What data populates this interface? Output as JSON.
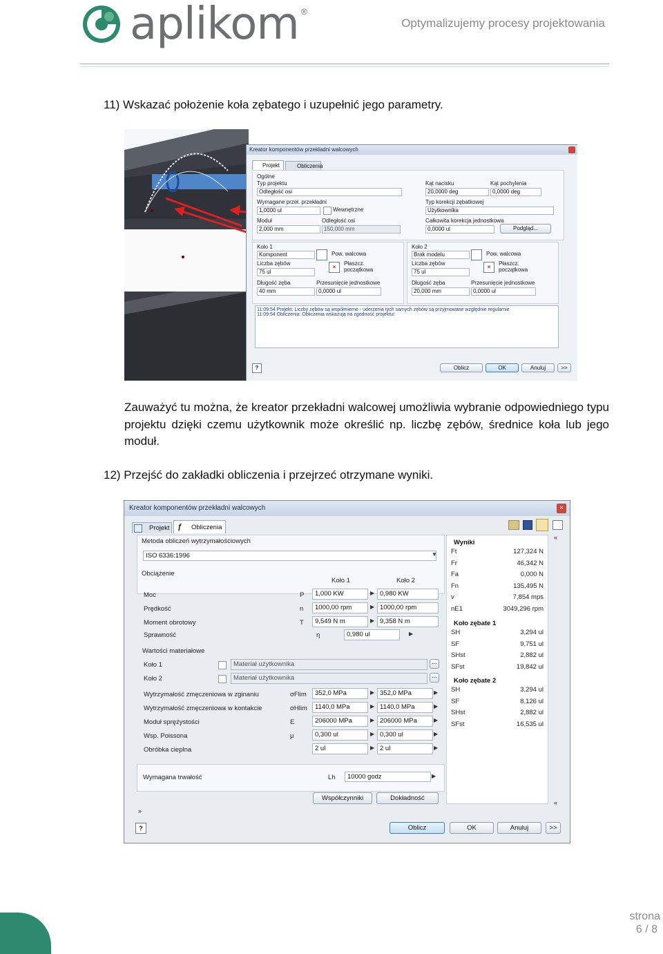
{
  "header": {
    "logo_text": "aplikom",
    "logo_reg": "®",
    "tagline": "Optymalizujemy procesy projektowania",
    "brand_color": "#2d8a6c"
  },
  "step11": "11) Wskazać położenie koła zębatego i uzupełnić jego parametry.",
  "paragraph": "Zauważyć tu można, że kreator przekładni walcowej umożliwia wybranie odpowiedniego typu projektu dzięki czemu użytkownik może określić np. liczbę zębów, średnice koła lub jego moduł.",
  "step12": "12) Przejść do zakładki obliczenia i przejrzeć otrzymane wyniki.",
  "dialog1": {
    "title": "Kreator komponentów przekładni walcowych",
    "tabs": [
      "Projekt",
      "Obliczenia"
    ],
    "general_label": "Ogólne",
    "project_type_label": "Typ projektu",
    "project_type_value": "Odległość osi",
    "helix_label": "Kąt nacisku",
    "helix_value": "20,0000 deg",
    "helix2_label": "Kąt pochylenia",
    "helix2_value": "0,0000 deg",
    "ratio_label": "Wymagane przeł. przekładni",
    "ratio_value": "1,0000 ul",
    "internal_label": "Wewnętrzne",
    "correction_type_label": "Typ korekcji zębatkowej",
    "correction_type_value": "Użytkownika",
    "module_label": "Moduł",
    "module_value": "2,000 mm",
    "center_label": "Odległość osi",
    "center_value": "150,000 mm",
    "total_corr_label": "Całkowita korekcja jednostkowa",
    "total_corr_value": "0,0000 ul",
    "preview_btn": "Podgląd...",
    "gear1_label": "Koło 1",
    "gear1_type": "Komponent",
    "gear2_label": "Koło 2",
    "gear2_type": "Brak modelu",
    "cyl_face": "Pow. walcowa",
    "start_plane": "Płaszcz. początkowa",
    "teeth_label": "Liczba zębów",
    "teeth1": "75 ul",
    "teeth2": "75 ul",
    "width_label": "Długość zęba",
    "width1": "40 mm",
    "width2": "20,000 mm",
    "shift_label": "Przesunięcie jednostkowe",
    "shift1": "0,0000 ul",
    "shift2": "0,0000 ul",
    "log1": "11:09:54 Projekt: Liczby zębów są współmierne - uderzenia tych samych zębów są przyjmowane względnie regularnie",
    "log2": "11:09:54 Obliczenia: Obliczenia wskazują na zgodność projektu!",
    "btn_calc": "Oblicz",
    "btn_ok": "OK",
    "btn_cancel": "Anuluj",
    "btn_more": ">>"
  },
  "dialog2": {
    "title": "Kreator komponentów przekładni walcowych",
    "tabs": [
      "Projekt",
      "Obliczenia"
    ],
    "method_label": "Metoda obliczeń wytrzymałościowych",
    "method_value": "ISO 6336:1996",
    "load_label": "Obciążenie",
    "col1": "Koło 1",
    "col2": "Koło 2",
    "rows": [
      {
        "label": "Moc",
        "sym": "P",
        "v1": "1,000 KW",
        "v2": "0,980 KW"
      },
      {
        "label": "Prędkość",
        "sym": "n",
        "v1": "1000,00 rpm",
        "v2": "1000,00 rpm"
      },
      {
        "label": "Moment obrotowy",
        "sym": "T",
        "v1": "9,549 N m",
        "v2": "9,358 N m"
      }
    ],
    "eff_label": "Sprawność",
    "eff_sym": "η",
    "eff_value": "0,980 ul",
    "material_label": "Wartości materiałowe",
    "mat_rows": [
      {
        "label": "Koło 1",
        "value": "Materiał użytkownika"
      },
      {
        "label": "Koło 2",
        "value": "Materiał użytkownika"
      }
    ],
    "prop_rows": [
      {
        "label": "Wytrzymałość zmęczeniowa w zginaniu",
        "sym": "σFlim",
        "v1": "352,0 MPa",
        "v2": "352,0 MPa"
      },
      {
        "label": "Wytrzymałość zmęczeniowa w kontakcie",
        "sym": "σHlim",
        "v1": "1140,0 MPa",
        "v2": "1140,0 MPa"
      },
      {
        "label": "Moduł sprężystości",
        "sym": "E",
        "v1": "206000 MPa",
        "v2": "206000 MPa"
      },
      {
        "label": "Wsp. Poissona",
        "sym": "μ",
        "v1": "0,300 ul",
        "v2": "0,300 ul"
      },
      {
        "label": "Obróbka cieplna",
        "sym": "",
        "v1": "2 ul",
        "v2": "2 ul"
      }
    ],
    "life_label": "Wymagana trwałość",
    "life_sym": "Lh",
    "life_value": "10000 godz",
    "coef_btn": "Współczynniki",
    "acc_btn": "Dokładność",
    "results_title": "Wyniki",
    "results_general": [
      {
        "k": "Ft",
        "v": "127,324 N"
      },
      {
        "k": "Fr",
        "v": "46,342 N"
      },
      {
        "k": "Fa",
        "v": "0,000 N"
      },
      {
        "k": "Fn",
        "v": "135,495 N"
      },
      {
        "k": "v",
        "v": "7,854 mps"
      },
      {
        "k": "nE1",
        "v": "3049,296 rpm"
      }
    ],
    "gear1_header": "Koło zębate 1",
    "results_gear1": [
      {
        "k": "SH",
        "v": "3,294 ul"
      },
      {
        "k": "SF",
        "v": "9,751 ul"
      },
      {
        "k": "SHst",
        "v": "2,882 ul"
      },
      {
        "k": "SFst",
        "v": "19,842 ul"
      }
    ],
    "gear2_header": "Koło zębate 2",
    "results_gear2": [
      {
        "k": "SH",
        "v": "3,294 ul"
      },
      {
        "k": "SF",
        "v": "8,126 ul"
      },
      {
        "k": "SHst",
        "v": "2,882 ul"
      },
      {
        "k": "SFst",
        "v": "16,535 ul"
      }
    ],
    "btn_calc": "Oblicz",
    "btn_ok": "OK",
    "btn_cancel": "Anuluj",
    "btn_more": ">>"
  },
  "footer": {
    "page_label": "strona",
    "page_num": "6 / 8"
  }
}
